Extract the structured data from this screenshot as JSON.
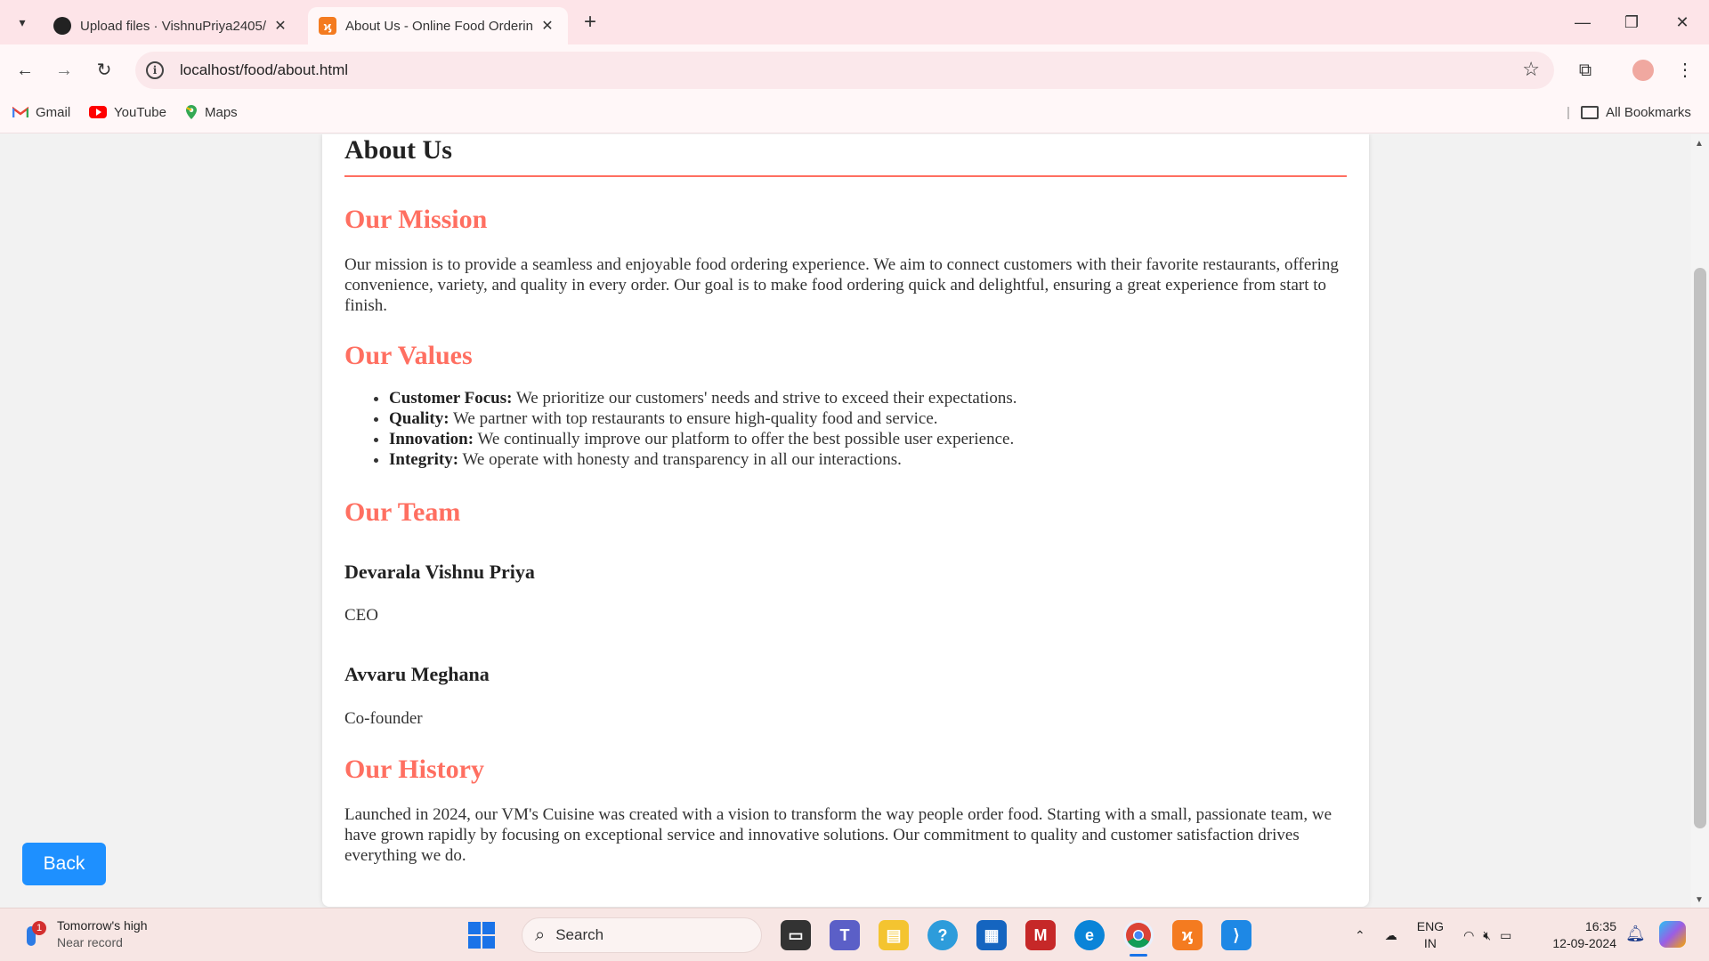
{
  "browser": {
    "tabs": [
      {
        "title": "Upload files · VishnuPriya2405/",
        "active": false,
        "icon": "github-icon"
      },
      {
        "title": "About Us - Online Food Orderin",
        "active": true,
        "icon": "xampp-icon"
      }
    ],
    "url": "localhost/food/about.html",
    "bookmarks": [
      {
        "label": "Gmail",
        "icon": "gmail-icon"
      },
      {
        "label": "YouTube",
        "icon": "youtube-icon"
      },
      {
        "label": "Maps",
        "icon": "maps-icon"
      }
    ],
    "all_bookmarks_label": "All Bookmarks"
  },
  "page": {
    "title": "About Us",
    "mission": {
      "heading": "Our Mission",
      "text": "Our mission is to provide a seamless and enjoyable food ordering experience. We aim to connect customers with their favorite restaurants, offering convenience, variety, and quality in every order. Our goal is to make food ordering quick and delightful, ensuring a great experience from start to finish."
    },
    "values": {
      "heading": "Our Values",
      "items": [
        {
          "term": "Customer Focus:",
          "text": " We prioritize our customers' needs and strive to exceed their expectations."
        },
        {
          "term": "Quality:",
          "text": " We partner with top restaurants to ensure high-quality food and service."
        },
        {
          "term": "Innovation:",
          "text": " We continually improve our platform to offer the best possible user experience."
        },
        {
          "term": "Integrity:",
          "text": " We operate with honesty and transparency in all our interactions."
        }
      ]
    },
    "team": {
      "heading": "Our Team",
      "members": [
        {
          "name": "Devarala Vishnu Priya",
          "role": "CEO"
        },
        {
          "name": "Avvaru Meghana",
          "role": "Co-founder"
        }
      ]
    },
    "history": {
      "heading": "Our History",
      "text": "Launched in 2024, our VM's Cuisine was created with a vision to transform the way people order food. Starting with a small, passionate team, we have grown rapidly by focusing on exceptional service and innovative solutions. Our commitment to quality and customer satisfaction drives everything we do."
    },
    "back_button": "Back"
  },
  "taskbar": {
    "weather_title": "Tomorrow's high",
    "weather_sub": "Near record",
    "weather_badge": "1",
    "search_placeholder": "Search",
    "lang_top": "ENG",
    "lang_bottom": "IN",
    "time": "16:35",
    "date": "12-09-2024"
  },
  "colors": {
    "accent": "#ff6f61",
    "button": "#1e90ff",
    "tabbar": "#fde4e8"
  }
}
